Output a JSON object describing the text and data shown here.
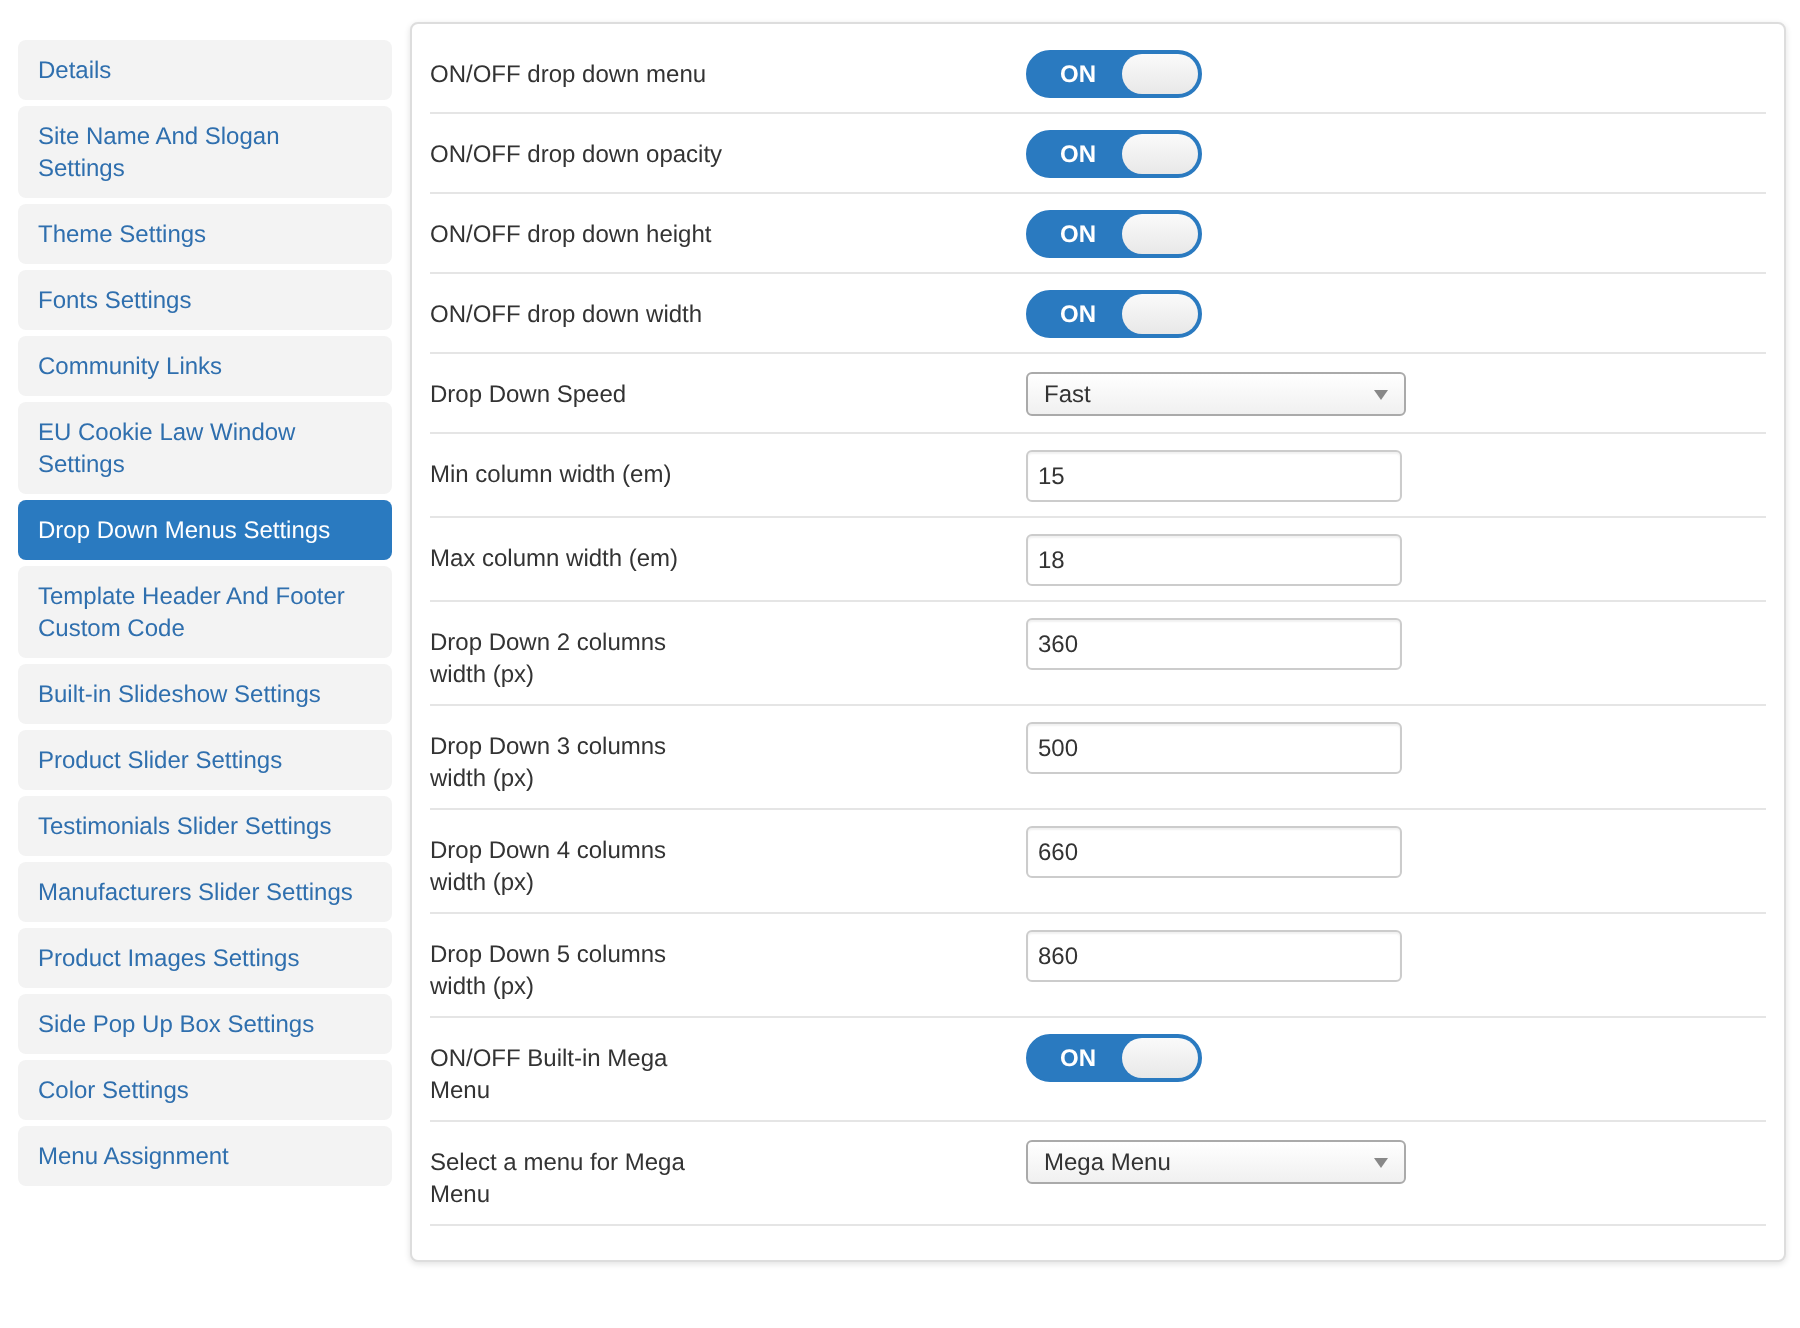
{
  "sidebar": {
    "items": [
      {
        "label": "Details",
        "selected": false
      },
      {
        "label": "Site Name And Slogan Settings",
        "selected": false
      },
      {
        "label": "Theme Settings",
        "selected": false
      },
      {
        "label": "Fonts Settings",
        "selected": false
      },
      {
        "label": "Community Links",
        "selected": false
      },
      {
        "label": "EU Cookie Law Window Settings",
        "selected": false
      },
      {
        "label": "Drop Down Menus Settings",
        "selected": true
      },
      {
        "label": "Template Header And Footer\nCustom Code",
        "selected": false
      },
      {
        "label": "Built-in Slideshow Settings",
        "selected": false
      },
      {
        "label": "Product Slider Settings",
        "selected": false
      },
      {
        "label": "Testimonials Slider Settings",
        "selected": false
      },
      {
        "label": "Manufacturers Slider Settings",
        "selected": false
      },
      {
        "label": "Product Images Settings",
        "selected": false
      },
      {
        "label": "Side Pop Up Box Settings",
        "selected": false
      },
      {
        "label": "Color Settings",
        "selected": false
      },
      {
        "label": "Menu Assignment",
        "selected": false
      }
    ]
  },
  "settings": [
    {
      "kind": "toggle",
      "label": "ON/OFF drop down menu",
      "on": true,
      "text": "ON"
    },
    {
      "kind": "toggle",
      "label": "ON/OFF drop down opacity",
      "on": true,
      "text": "ON"
    },
    {
      "kind": "toggle",
      "label": "ON/OFF drop down height",
      "on": true,
      "text": "ON"
    },
    {
      "kind": "toggle",
      "label": "ON/OFF drop down width",
      "on": true,
      "text": "ON"
    },
    {
      "kind": "select",
      "label": "Drop Down Speed",
      "value": "Fast"
    },
    {
      "kind": "input",
      "label": "Min column width (em)",
      "value": "15"
    },
    {
      "kind": "input",
      "label": "Max column width (em)",
      "value": "18"
    },
    {
      "kind": "input",
      "label": "Drop Down 2 columns\nwidth (px)",
      "value": "360"
    },
    {
      "kind": "input",
      "label": "Drop Down 3 columns\nwidth (px)",
      "value": "500"
    },
    {
      "kind": "input",
      "label": "Drop Down 4 columns\nwidth (px)",
      "value": "660"
    },
    {
      "kind": "input",
      "label": "Drop Down 5 columns\nwidth (px)",
      "value": "860"
    },
    {
      "kind": "toggle",
      "label": "ON/OFF Built-in Mega\nMenu",
      "on": true,
      "text": "ON"
    },
    {
      "kind": "select",
      "label": "Select a menu for Mega\nMenu",
      "value": "Mega Menu"
    }
  ]
}
